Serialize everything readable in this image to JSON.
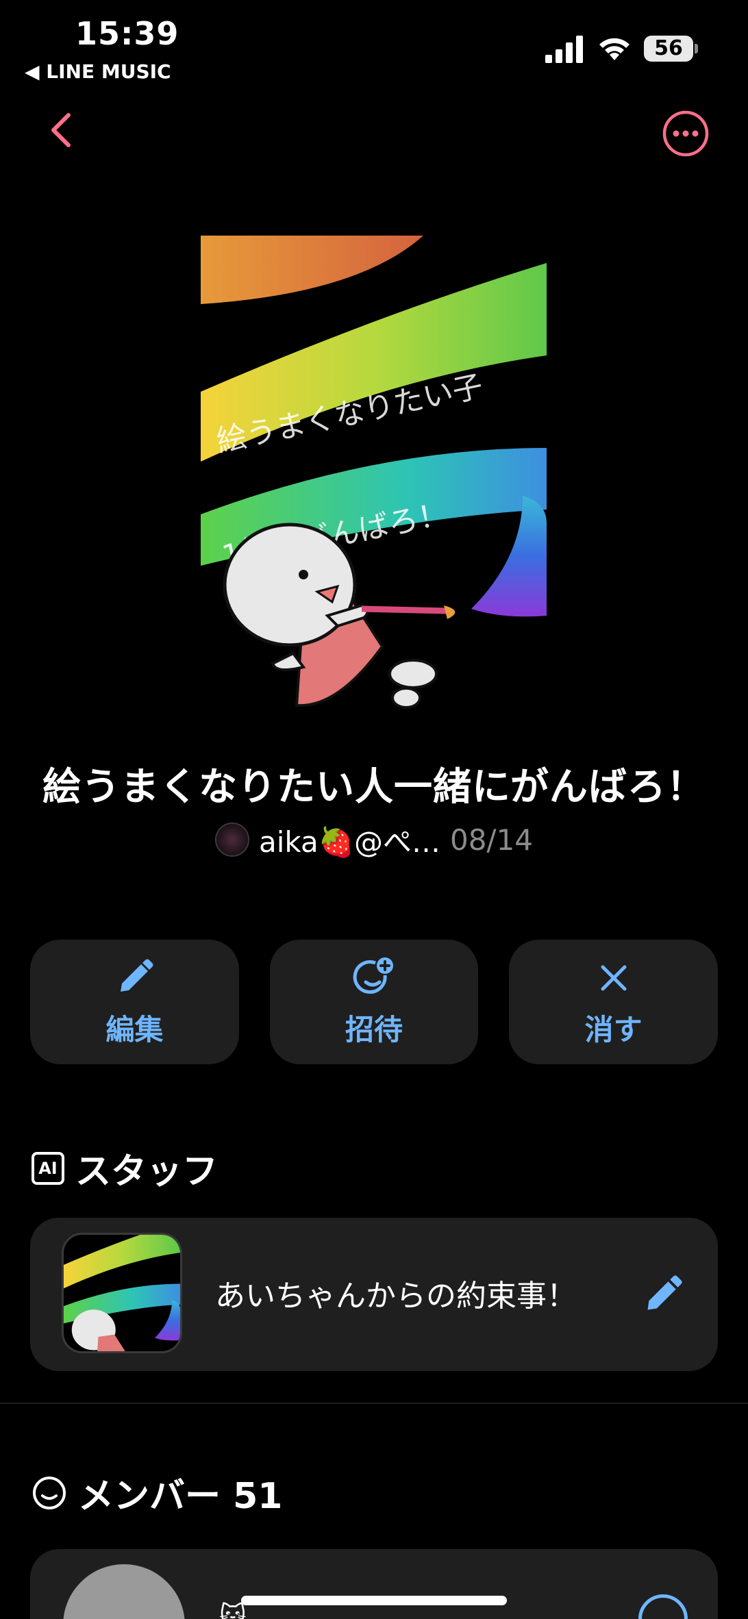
{
  "status": {
    "time": "15:39",
    "back_app": "◀ LINE MUSIC",
    "battery": "56"
  },
  "nav": {
    "back_icon": "chevron-left-icon",
    "more_icon": "more-horizontal-circle-icon",
    "accent": "#ff6f8a"
  },
  "playlist": {
    "title": "絵うまくなりたい人一緒にがんばろ！",
    "author": "aika🍓@ぺ…",
    "date": "08/14",
    "cover_banner_1": "絵うまくなりたい子",
    "cover_banner_2": "1緒にがんばろ！"
  },
  "actions": [
    {
      "label": "編集",
      "icon": "pencil-icon"
    },
    {
      "label": "招待",
      "icon": "invite-face-plus-icon"
    },
    {
      "label": "消す",
      "icon": "close-icon"
    }
  ],
  "staff": {
    "heading": "スタッフ",
    "ai_badge": "AI",
    "item_title": "あいちゃんからの約束事！",
    "edit_icon": "pencil-icon"
  },
  "members": {
    "heading": "メンバー 51"
  },
  "colors": {
    "accent_blue": "#6fb5ff",
    "card_bg": "#1f1f1f",
    "nav_pink": "#ff6f8a"
  }
}
